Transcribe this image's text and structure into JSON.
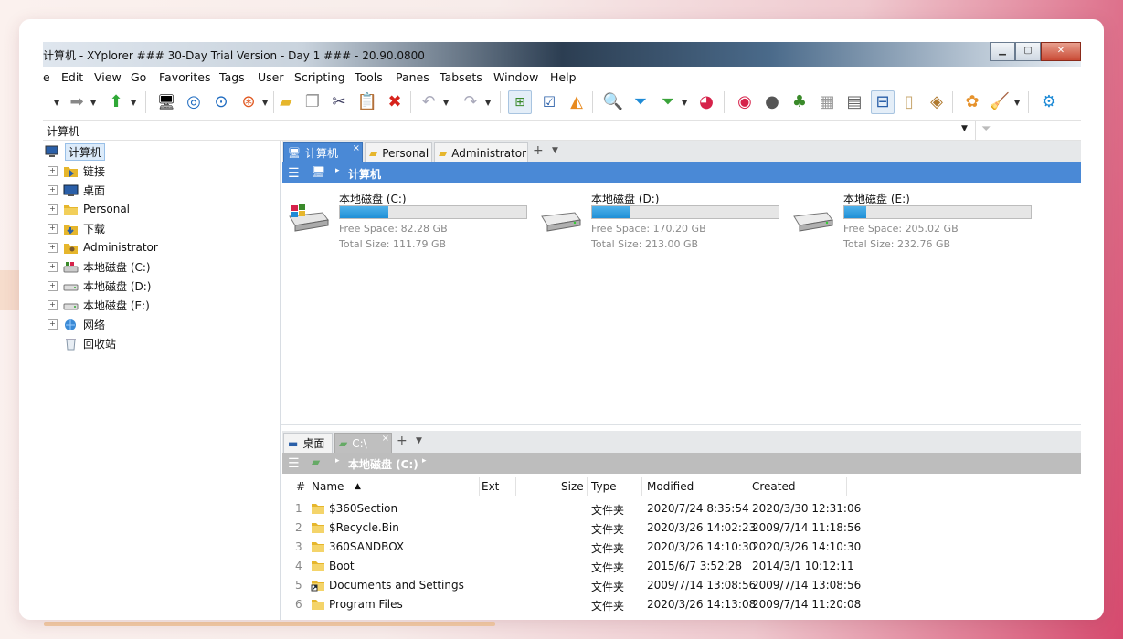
{
  "window": {
    "title": "计算机 - XYplorer ### 30-Day Trial Version - Day 1 ### - 20.90.0800"
  },
  "menu": [
    "e",
    "Edit",
    "View",
    "Go",
    "Favorites",
    "Tags",
    "User",
    "Scripting",
    "Tools",
    "Panes",
    "Tabsets",
    "Window",
    "Help"
  ],
  "address": {
    "value": "计算机"
  },
  "tree": {
    "root": "计算机",
    "items": [
      {
        "label": "链接",
        "icon": "folder-link-icon"
      },
      {
        "label": "桌面",
        "icon": "desktop-icon"
      },
      {
        "label": "Personal",
        "icon": "folder-icon"
      },
      {
        "label": "下载",
        "icon": "downloads-folder-icon"
      },
      {
        "label": "Administrator",
        "icon": "user-folder-icon"
      },
      {
        "label": "本地磁盘 (C:)",
        "icon": "system-drive-icon"
      },
      {
        "label": "本地磁盘 (D:)",
        "icon": "drive-icon"
      },
      {
        "label": "本地磁盘 (E:)",
        "icon": "drive-icon"
      },
      {
        "label": "网络",
        "icon": "network-icon"
      },
      {
        "label": "回收站",
        "icon": "recycle-bin-icon"
      }
    ]
  },
  "pane1": {
    "tabs": [
      "计算机",
      "Personal",
      "Administrator"
    ],
    "breadcrumb": "计算机",
    "drives": [
      {
        "name": "本地磁盘 (C:)",
        "free": "Free Space: 82.28 GB",
        "total": "Total Size: 111.79 GB",
        "used_fraction": 0.26,
        "system": true
      },
      {
        "name": "本地磁盘 (D:)",
        "free": "Free Space: 170.20 GB",
        "total": "Total Size: 213.00 GB",
        "used_fraction": 0.2,
        "system": false
      },
      {
        "name": "本地磁盘 (E:)",
        "free": "Free Space: 205.02 GB",
        "total": "Total Size: 232.76 GB",
        "used_fraction": 0.12,
        "system": false
      }
    ]
  },
  "pane2": {
    "tabs": [
      "桌面",
      "C:\\"
    ],
    "breadcrumb": "本地磁盘 (C:)",
    "columns": {
      "num": "#",
      "name": "Name",
      "ext": "Ext",
      "size": "Size",
      "type": "Type",
      "modified": "Modified",
      "created": "Created"
    },
    "rows": [
      {
        "num": "1",
        "name": "$360Section",
        "type": "文件夹",
        "modified": "2020/7/24 8:35:54",
        "created": "2020/3/30 12:31:06",
        "shortcut": false
      },
      {
        "num": "2",
        "name": "$Recycle.Bin",
        "type": "文件夹",
        "modified": "2020/3/26 14:02:23",
        "created": "2009/7/14 11:18:56",
        "shortcut": false
      },
      {
        "num": "3",
        "name": "360SANDBOX",
        "type": "文件夹",
        "modified": "2020/3/26 14:10:30",
        "created": "2020/3/26 14:10:30",
        "shortcut": false
      },
      {
        "num": "4",
        "name": "Boot",
        "type": "文件夹",
        "modified": "2015/6/7 3:52:28",
        "created": "2014/3/1 10:12:11",
        "shortcut": false
      },
      {
        "num": "5",
        "name": "Documents and Settings",
        "type": "文件夹",
        "modified": "2009/7/14 13:08:56",
        "created": "2009/7/14 13:08:56",
        "shortcut": true
      },
      {
        "num": "6",
        "name": "Program Files",
        "type": "文件夹",
        "modified": "2020/3/26 14:13:08",
        "created": "2009/7/14 11:20:08",
        "shortcut": false
      }
    ]
  },
  "colors": {
    "accent_blue": "#4a89d6",
    "inactive_gray": "#bfbfbf",
    "bar_fill": "#1f8fd6"
  }
}
